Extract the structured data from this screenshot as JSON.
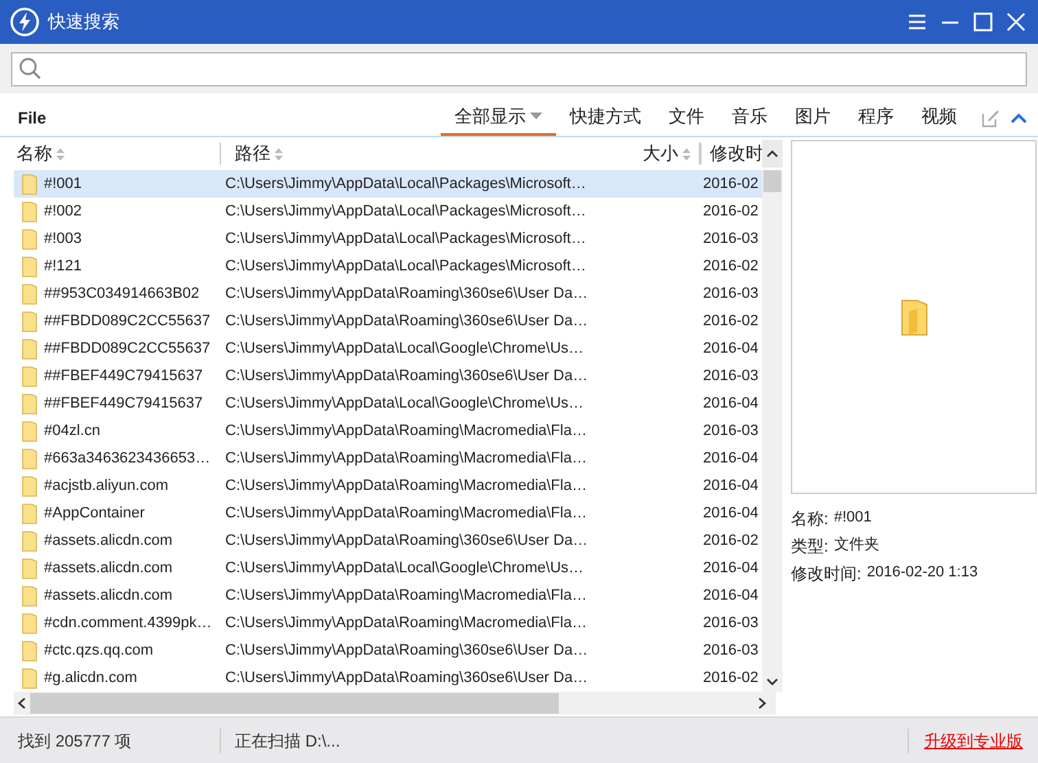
{
  "window": {
    "title": "快速搜索"
  },
  "section_label": "File",
  "filters": [
    {
      "label": "全部显示",
      "selected": true,
      "dropdown": true
    },
    {
      "label": "快捷方式",
      "selected": false
    },
    {
      "label": "文件",
      "selected": false
    },
    {
      "label": "音乐",
      "selected": false
    },
    {
      "label": "图片",
      "selected": false
    },
    {
      "label": "程序",
      "selected": false
    },
    {
      "label": "视频",
      "selected": false
    }
  ],
  "table": {
    "columns": [
      {
        "label": "名称",
        "sortable": true
      },
      {
        "label": "路径",
        "sortable": true
      },
      {
        "label": "大小",
        "sortable": true
      },
      {
        "label": "修改时",
        "sortable": false
      }
    ],
    "rows": [
      {
        "name": "#!001",
        "path": "C:\\Users\\Jimmy\\AppData\\Local\\Packages\\Microsoft…",
        "modified": "2016-02",
        "selected": true
      },
      {
        "name": "#!002",
        "path": "C:\\Users\\Jimmy\\AppData\\Local\\Packages\\Microsoft…",
        "modified": "2016-02",
        "selected": false
      },
      {
        "name": "#!003",
        "path": "C:\\Users\\Jimmy\\AppData\\Local\\Packages\\Microsoft…",
        "modified": "2016-03",
        "selected": false
      },
      {
        "name": "#!121",
        "path": "C:\\Users\\Jimmy\\AppData\\Local\\Packages\\Microsoft…",
        "modified": "2016-02",
        "selected": false
      },
      {
        "name": "##953C034914663B02",
        "path": "C:\\Users\\Jimmy\\AppData\\Roaming\\360se6\\User Da…",
        "modified": "2016-03",
        "selected": false
      },
      {
        "name": "##FBDD089C2CC55637",
        "path": "C:\\Users\\Jimmy\\AppData\\Roaming\\360se6\\User Da…",
        "modified": "2016-02",
        "selected": false
      },
      {
        "name": "##FBDD089C2CC55637",
        "path": "C:\\Users\\Jimmy\\AppData\\Local\\Google\\Chrome\\Us…",
        "modified": "2016-04",
        "selected": false
      },
      {
        "name": "##FBEF449C79415637",
        "path": "C:\\Users\\Jimmy\\AppData\\Roaming\\360se6\\User Da…",
        "modified": "2016-03",
        "selected": false
      },
      {
        "name": "##FBEF449C79415637",
        "path": "C:\\Users\\Jimmy\\AppData\\Local\\Google\\Chrome\\Us…",
        "modified": "2016-04",
        "selected": false
      },
      {
        "name": "#04zl.cn",
        "path": "C:\\Users\\Jimmy\\AppData\\Roaming\\Macromedia\\Fla…",
        "modified": "2016-03",
        "selected": false
      },
      {
        "name": "#663a3463623436653…",
        "path": "C:\\Users\\Jimmy\\AppData\\Roaming\\Macromedia\\Fla…",
        "modified": "2016-04",
        "selected": false
      },
      {
        "name": "#acjstb.aliyun.com",
        "path": "C:\\Users\\Jimmy\\AppData\\Roaming\\Macromedia\\Fla…",
        "modified": "2016-04",
        "selected": false
      },
      {
        "name": "#AppContainer",
        "path": "C:\\Users\\Jimmy\\AppData\\Roaming\\Macromedia\\Fla…",
        "modified": "2016-04",
        "selected": false
      },
      {
        "name": "#assets.alicdn.com",
        "path": "C:\\Users\\Jimmy\\AppData\\Roaming\\360se6\\User Da…",
        "modified": "2016-02",
        "selected": false
      },
      {
        "name": "#assets.alicdn.com",
        "path": "C:\\Users\\Jimmy\\AppData\\Local\\Google\\Chrome\\Us…",
        "modified": "2016-04",
        "selected": false
      },
      {
        "name": "#assets.alicdn.com",
        "path": "C:\\Users\\Jimmy\\AppData\\Roaming\\Macromedia\\Fla…",
        "modified": "2016-04",
        "selected": false
      },
      {
        "name": "#cdn.comment.4399pk…",
        "path": "C:\\Users\\Jimmy\\AppData\\Roaming\\Macromedia\\Fla…",
        "modified": "2016-03",
        "selected": false
      },
      {
        "name": "#ctc.qzs.qq.com",
        "path": "C:\\Users\\Jimmy\\AppData\\Roaming\\360se6\\User Da…",
        "modified": "2016-03",
        "selected": false
      },
      {
        "name": "#g.alicdn.com",
        "path": "C:\\Users\\Jimmy\\AppData\\Roaming\\360se6\\User Da…",
        "modified": "2016-02",
        "selected": false
      }
    ]
  },
  "details": [
    {
      "label": "名称:",
      "value": "#!001"
    },
    {
      "label": "类型:",
      "value": "文件夹"
    },
    {
      "label": "修改时间:",
      "value": "2016-02-20 1:13"
    }
  ],
  "status_bar": {
    "count": "找到 205777 项",
    "scan": "正在扫描 D:\\...",
    "upgrade_link": "升级到专业版"
  }
}
